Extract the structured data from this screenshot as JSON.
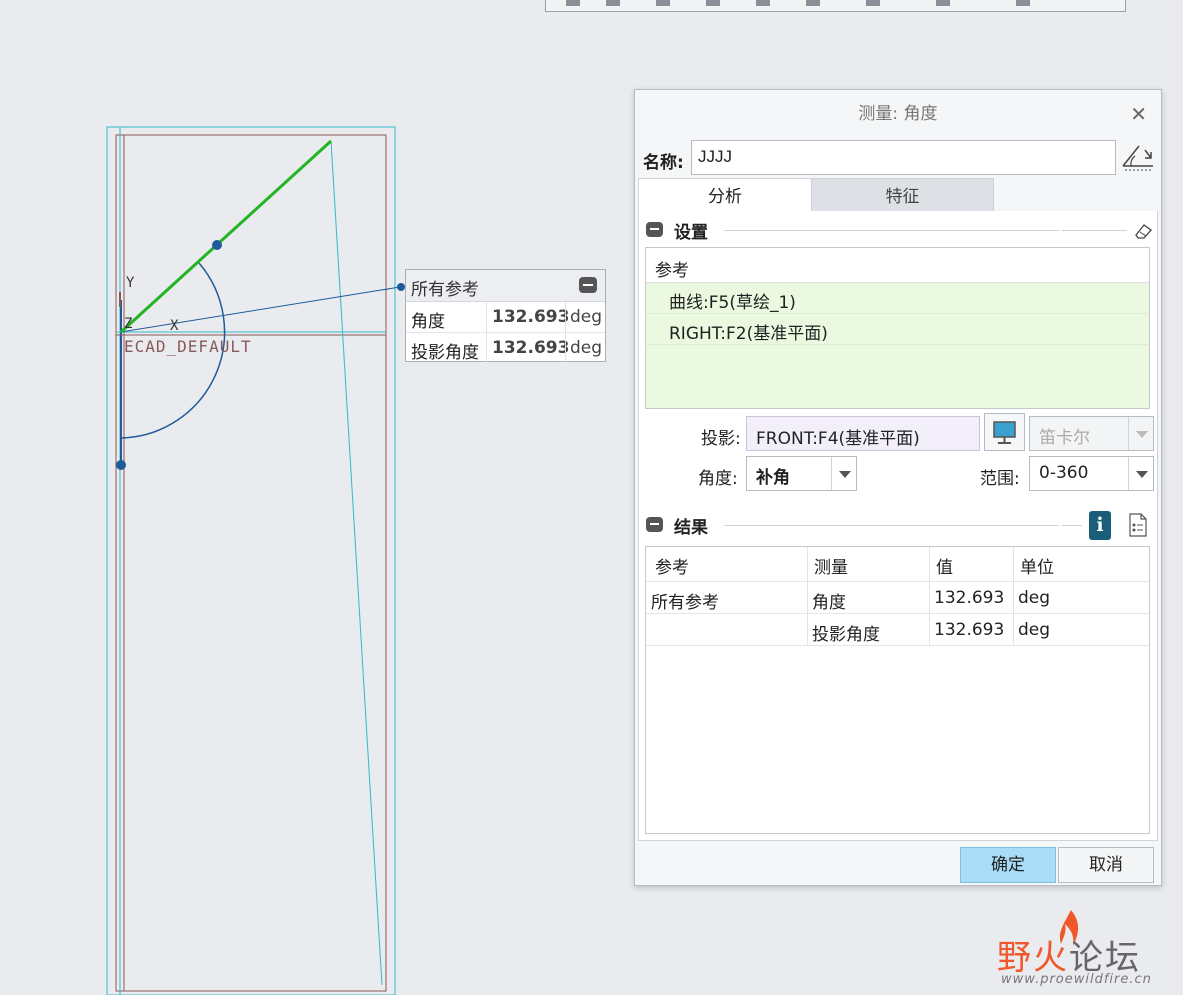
{
  "viewport": {
    "x_axis": "X",
    "y_axis": "Y",
    "z_axis": "Z",
    "csys_name": "ECAD_DEFAULT"
  },
  "measure_tag": {
    "title": "所有参考",
    "rows": [
      {
        "label": "角度",
        "value": "132.693",
        "unit": "deg"
      },
      {
        "label": "投影角度",
        "value": "132.693",
        "unit": "deg"
      }
    ]
  },
  "dialog": {
    "title": "测量: 角度",
    "name_label": "名称:",
    "name_value": "JJJJ",
    "tabs": [
      {
        "label": "分析",
        "active": true
      },
      {
        "label": "特征",
        "active": false
      }
    ],
    "settings": {
      "title": "设置",
      "ref_header": "参考",
      "references": [
        "曲线:F5(草绘_1)",
        "RIGHT:F2(基准平面)"
      ],
      "projection_label": "投影:",
      "projection_value": "FRONT:F4(基准平面)",
      "coord_type": "笛卡尔",
      "angle_label": "角度:",
      "angle_value": "补角",
      "range_label": "范围:",
      "range_value": "0-360"
    },
    "results": {
      "title": "结果",
      "headers": [
        "参考",
        "测量",
        "值",
        "单位"
      ],
      "rows": [
        {
          "ref": "所有参考",
          "measure": "角度",
          "value": "132.693",
          "unit": "deg"
        },
        {
          "ref": "",
          "measure": "投影角度",
          "value": "132.693",
          "unit": "deg"
        }
      ]
    },
    "ok_label": "确定",
    "cancel_label": "取消"
  },
  "watermark": {
    "name_a": "野火",
    "name_b": "论坛",
    "url": "www.proewildfire.cn"
  },
  "colors": {
    "accent_ok": "#a8dcf7",
    "ref_highlight": "#eaf9df",
    "projection_field": "#f2effa",
    "sketch_line": "#22b422",
    "measure_arc": "#1f5a9a"
  }
}
